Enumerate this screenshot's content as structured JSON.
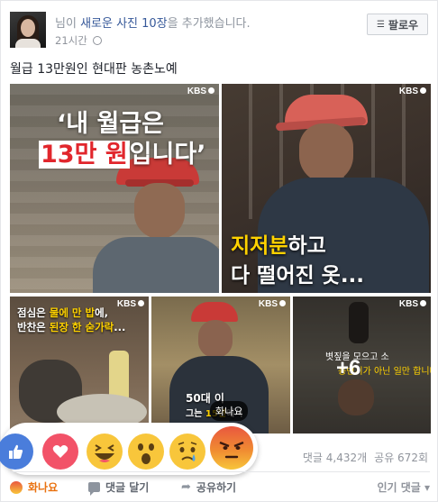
{
  "post": {
    "author_suffix": "님이",
    "headline_highlight": "새로운 사진 10장",
    "headline_tail": "을 추가했습니다.",
    "timestamp": "21시간",
    "follow_label": "팔로우",
    "text": "월급 13만원인 현대판 농촌노예"
  },
  "photos": {
    "kbs_label": "KBS",
    "p1_quote_line1": "‘내 월급은",
    "p1_quote_box": "13만 원",
    "p1_quote_tail": "입니다’",
    "p2_cap_yellow": "지저분",
    "p2_cap_rest": "하고",
    "p2_cap_line2": "다 떨어진 옷...",
    "p3_line1_a": "점심은 ",
    "p3_line1_y": "물에 만 밥",
    "p3_line1_b": "에,",
    "p3_line2_a": "반찬은 ",
    "p3_line2_y": "된장 한 숟가락",
    "p3_line2_b": "...",
    "p4_line1": "50대 이",
    "p4_line2_a": "그는 ",
    "p4_line2_y": "15년",
    "p4_line2_b": "에서",
    "p5_line1": "볏짚을 모으고 소",
    "p5_line2": "농번기가 아닌",
    "p5_line2b": "일만 합니다",
    "more_count": "+6"
  },
  "reactions": {
    "items": [
      "like-icon",
      "love-icon",
      "haha-icon",
      "wow-icon",
      "sad-icon",
      "angry-icon"
    ],
    "hover_label": "화나요",
    "colors": {
      "like": "#4a7ddb",
      "love": "#f25268",
      "emoji": "#f8c63b",
      "angry": "#e9573f"
    }
  },
  "stats": {
    "comments": "댓글 4,432개",
    "shares": "공유 672회"
  },
  "actions": {
    "react_label": "화나요",
    "comment_label": "댓글 달기",
    "share_label": "공유하기",
    "sort_label": "인기 댓글 ▾"
  }
}
